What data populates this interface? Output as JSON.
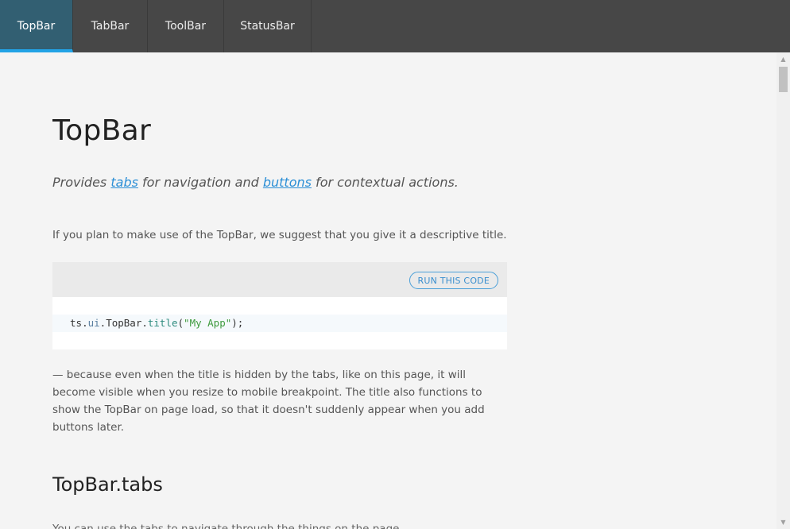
{
  "topbar": {
    "tabs": [
      {
        "label": "TopBar",
        "active": true
      },
      {
        "label": "TabBar",
        "active": false
      },
      {
        "label": "ToolBar",
        "active": false
      },
      {
        "label": "StatusBar",
        "active": false
      }
    ],
    "accent_color": "#22a3e6"
  },
  "main": {
    "title": "TopBar",
    "lead": {
      "pre": "Provides ",
      "link1": "tabs",
      "mid": " for navigation and ",
      "link2": "buttons",
      "post": " for contextual actions."
    },
    "para1": "If you plan to make use of the TopBar, we suggest that you give it a descriptive title.",
    "code": {
      "run_label": "RUN THIS CODE",
      "tokens": {
        "t1": "ts",
        "t2": ".",
        "t3": "ui",
        "t4": ".",
        "t5": "TopBar",
        "t6": ".",
        "t7": "title",
        "t8": "(",
        "t9": "\"My App\"",
        "t10": ");"
      }
    },
    "para2": "— because even when the title is hidden by the tabs, like on this page, it will become visible when you resize to mobile breakpoint. The title also functions to show the TopBar on page load, so that it doesn't suddenly appear when you add buttons later.",
    "section_title": "TopBar.tabs",
    "para3": "You can use the tabs to navigate through the things on the page."
  },
  "scrollbar": {
    "up_icon": "arrow-up-icon",
    "down_icon": "arrow-down-icon"
  }
}
